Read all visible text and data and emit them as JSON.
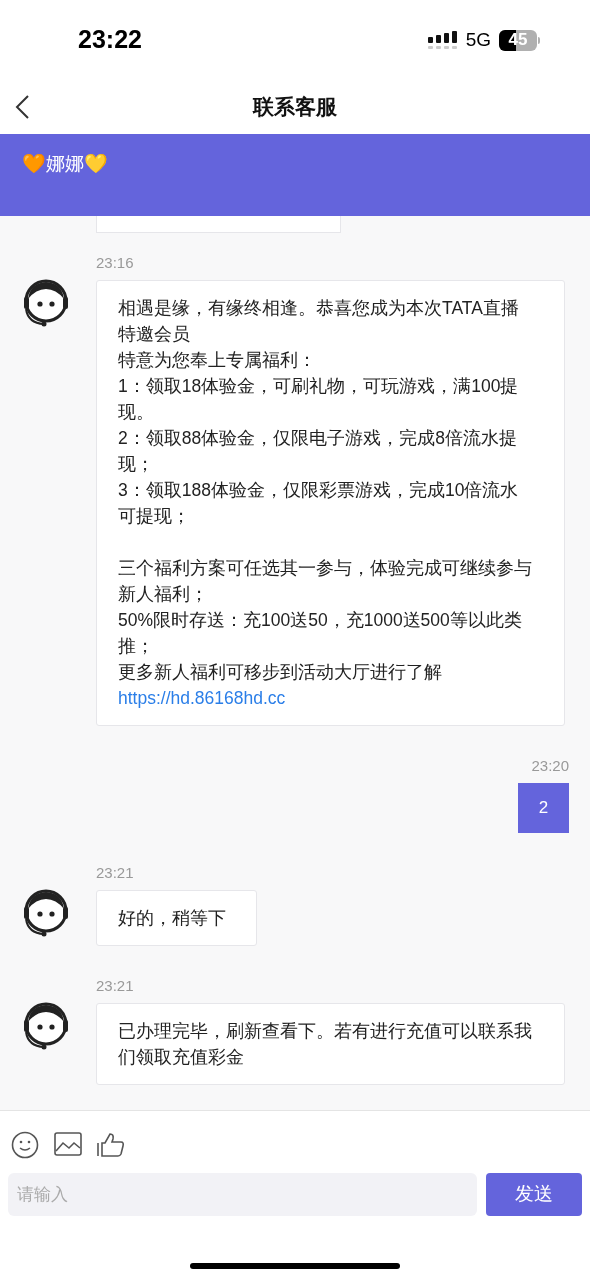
{
  "status_bar": {
    "time": "23:22",
    "network": "5G",
    "battery": "45"
  },
  "header": {
    "title": "联系客服"
  },
  "banner": {
    "name": "娜娜",
    "emoji_left": "🧡",
    "emoji_right": "💛"
  },
  "messages": [
    {
      "kind": "agent",
      "time": "23:16",
      "paragraphs": [
        [
          "相遇是缘，有缘终相逢。恭喜您成为本次TATA直播特邀会员",
          "特意为您奉上专属福利：",
          "1：领取18体验金，可刷礼物，可玩游戏，满100提现。",
          "2：领取88体验金，仅限电子游戏，完成8倍流水提现；",
          "3：领取188体验金，仅限彩票游戏，完成10倍流水可提现；"
        ],
        [
          "三个福利方案可任选其一参与，体验完成可继续参与新人福利；",
          "50%限时存送：充100送50，充1000送500等以此类推；",
          "更多新人福利可移步到活动大厅进行了解"
        ]
      ],
      "link": "https://hd.86168hd.cc"
    },
    {
      "kind": "user",
      "time": "23:20",
      "text": "2"
    },
    {
      "kind": "agent",
      "time": "23:21",
      "text": "好的，稍等下"
    },
    {
      "kind": "agent",
      "time": "23:21",
      "text": "已办理完毕，刷新查看下。若有进行充值可以联系我们领取充值彩金"
    }
  ],
  "composer": {
    "placeholder": "请输入",
    "send": "发送"
  }
}
